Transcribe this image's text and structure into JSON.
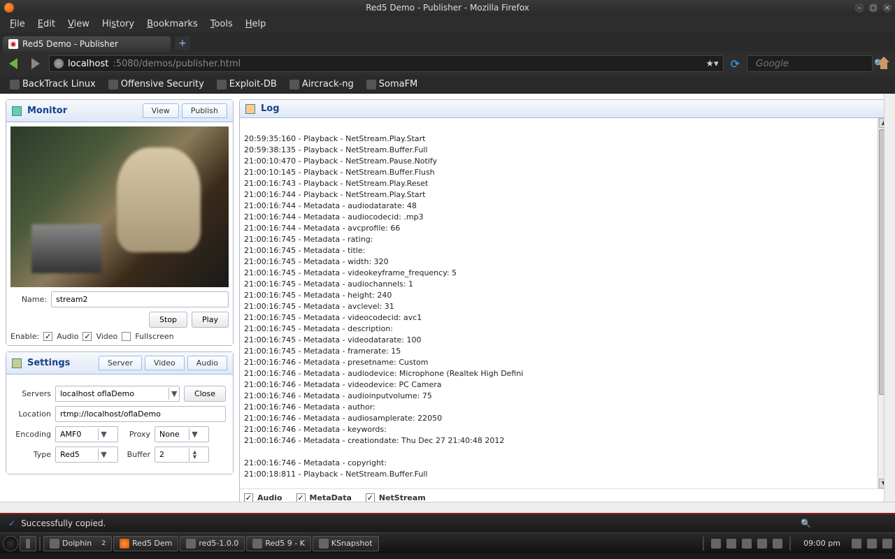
{
  "window": {
    "title": "Red5 Demo - Publisher - Mozilla Firefox"
  },
  "menu": {
    "file": "File",
    "edit": "Edit",
    "view": "View",
    "history": "History",
    "bookmarks": "Bookmarks",
    "tools": "Tools",
    "help": "Help"
  },
  "tab": {
    "title": "Red5 Demo - Publisher"
  },
  "url": {
    "domain": "localhost",
    "path": ":5080/demos/publisher.html"
  },
  "search": {
    "placeholder": "Google"
  },
  "bookmarks": [
    {
      "label": "BackTrack Linux"
    },
    {
      "label": "Offensive Security"
    },
    {
      "label": "Exploit-DB"
    },
    {
      "label": "Aircrack-ng"
    },
    {
      "label": "SomaFM"
    }
  ],
  "monitor": {
    "title": "Monitor",
    "tabs": {
      "view": "View",
      "publish": "Publish"
    },
    "name_label": "Name:",
    "name_value": "stream2",
    "stop": "Stop",
    "play": "Play",
    "enable_label": "Enable:",
    "audio": "Audio",
    "video": "Video",
    "fullscreen": "Fullscreen"
  },
  "settings": {
    "title": "Settings",
    "tabs": {
      "server": "Server",
      "video": "Video",
      "audio": "Audio"
    },
    "servers_label": "Servers",
    "servers_value": "localhost oflaDemo",
    "close": "Close",
    "location_label": "Location",
    "location_value": "rtmp://localhost/oflaDemo",
    "encoding_label": "Encoding",
    "encoding_value": "AMF0",
    "proxy_label": "Proxy",
    "proxy_value": "None",
    "type_label": "Type",
    "type_value": "Red5",
    "buffer_label": "Buffer",
    "buffer_value": "2"
  },
  "log": {
    "title": "Log",
    "lines": [
      "20:59:35:160 - Playback - NetStream.Play.Start",
      "20:59:38:135 - Playback - NetStream.Buffer.Full",
      "21:00:10:470 - Playback - NetStream.Pause.Notify",
      "21:00:10:145 - Playback - NetStream.Buffer.Flush",
      "21:00:16:743 - Playback - NetStream.Play.Reset",
      "21:00:16:744 - Playback - NetStream.Play.Start",
      "21:00:16:744 - Metadata - audiodatarate: 48",
      "21:00:16:744 - Metadata - audiocodecid: .mp3",
      "21:00:16:744 - Metadata - avcprofile: 66",
      "21:00:16:745 - Metadata - rating:",
      "21:00:16:745 - Metadata - title:",
      "21:00:16:745 - Metadata - width: 320",
      "21:00:16:745 - Metadata - videokeyframe_frequency: 5",
      "21:00:16:745 - Metadata - audiochannels: 1",
      "21:00:16:745 - Metadata - height: 240",
      "21:00:16:745 - Metadata - avclevel: 31",
      "21:00:16:745 - Metadata - videocodecid: avc1",
      "21:00:16:745 - Metadata - description:",
      "21:00:16:745 - Metadata - videodatarate: 100",
      "21:00:16:745 - Metadata - framerate: 15",
      "21:00:16:746 - Metadata - presetname: Custom",
      "21:00:16:746 - Metadata - audiodevice: Microphone (Realtek High Defini",
      "21:00:16:746 - Metadata - videodevice: PC Camera",
      "21:00:16:746 - Metadata - audioinputvolume: 75",
      "21:00:16:746 - Metadata - author:",
      "21:00:16:746 - Metadata - audiosamplerate: 22050",
      "21:00:16:746 - Metadata - keywords:",
      "21:00:16:746 - Metadata - creationdate: Thu Dec 27 21:40:48 2012",
      "",
      "21:00:16:746 - Metadata - copyright:",
      "21:00:18:811 - Playback - NetStream.Buffer.Full"
    ],
    "footer": {
      "audio": "Audio",
      "metadata": "MetaData",
      "netstream": "NetStream"
    }
  },
  "notify": {
    "text": "Successfully copied."
  },
  "taskbar": {
    "items": [
      "Dolphin",
      "Red5 Dem",
      "red5-1.0.0",
      "Red5 9 - K",
      "KSnapshot"
    ],
    "desktop_num": "2",
    "clock": "09:00 pm"
  }
}
